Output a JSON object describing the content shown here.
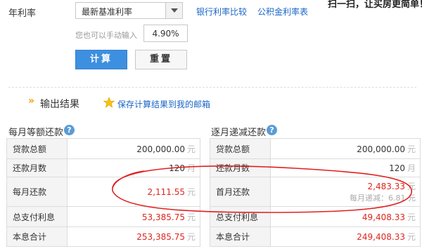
{
  "form": {
    "rate_label": "年利率",
    "rate_select": "最新基准利率",
    "links": [
      "银行利率比较",
      "公积金利率表"
    ],
    "promo": "扫一扫，让买房更简单！",
    "manual_hint": "您也可以手动输入",
    "rate_value": "4.90%",
    "calc_button": "计算",
    "reset_button": "重置"
  },
  "output": {
    "title": "输出结果",
    "save_link": "保存计算结果到我的邮箱"
  },
  "equal_installment": {
    "title": "每月等额还款",
    "rows": [
      {
        "label": "贷款总额",
        "value": "200,000.00",
        "unit": "元"
      },
      {
        "label": "还款月数",
        "value": "120",
        "unit": "月"
      },
      {
        "label": "每月还款",
        "value": "2,111.55",
        "unit": "元"
      },
      {
        "label": "总支付利息",
        "value": "53,385.75",
        "unit": "元"
      },
      {
        "label": "本息合计",
        "value": "253,385.75",
        "unit": "元"
      }
    ]
  },
  "decreasing": {
    "title": "逐月递减还款",
    "rows": [
      {
        "label": "贷款总额",
        "value": "200,000.00",
        "unit": "元"
      },
      {
        "label": "还款月数",
        "value": "120",
        "unit": "月"
      },
      {
        "label": "首月还款",
        "value": "2,483.33",
        "unit": "元",
        "sub": "每月递减：6.81 元"
      },
      {
        "label": "总支付利息",
        "value": "49,408.33",
        "unit": "元"
      },
      {
        "label": "本息合计",
        "value": "249,408.33",
        "unit": "元"
      }
    ]
  },
  "colors": {
    "accent_blue": "#3d8fe0",
    "link_blue": "#1a66c7",
    "value_red": "#e0241b",
    "annotation_red": "#e02020"
  }
}
